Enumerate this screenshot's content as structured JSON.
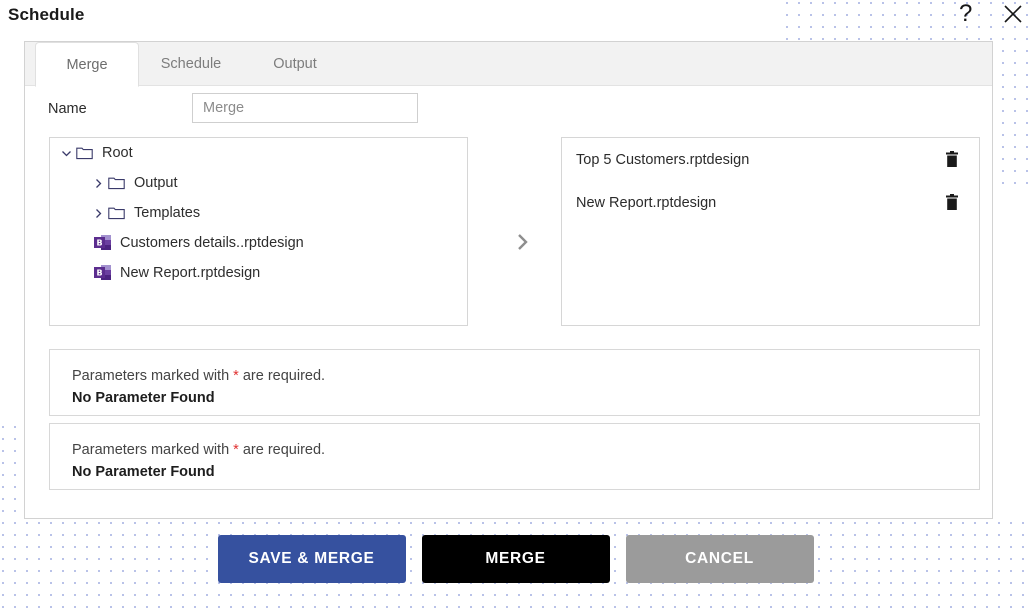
{
  "header": {
    "title": "Schedule",
    "help_icon": "question-mark-icon",
    "close_icon": "close-icon"
  },
  "tabs": [
    {
      "label": "Merge",
      "active": true
    },
    {
      "label": "Schedule",
      "active": false
    },
    {
      "label": "Output",
      "active": false
    }
  ],
  "form": {
    "name_label": "Name",
    "name_value": "",
    "name_placeholder": "Merge"
  },
  "tree": {
    "root": {
      "label": "Root",
      "icon": "folder-icon",
      "caret": "chevron-down-icon",
      "expanded": true
    },
    "folders": [
      {
        "label": "Output",
        "icon": "folder-icon",
        "caret": "chevron-right-icon",
        "expanded": false
      },
      {
        "label": "Templates",
        "icon": "folder-icon",
        "caret": "chevron-right-icon",
        "expanded": false
      }
    ],
    "files": [
      {
        "label": "Customers details..rptdesign",
        "icon": "birt-report-icon"
      },
      {
        "label": "New Report.rptdesign",
        "icon": "birt-report-icon"
      }
    ]
  },
  "transfer": {
    "icon": "chevron-right-icon"
  },
  "selected": {
    "items": [
      {
        "label": "Top 5 Customers.rptdesign",
        "delete_icon": "trash-icon"
      },
      {
        "label": "New Report.rptdesign",
        "delete_icon": "trash-icon"
      }
    ]
  },
  "parameters": [
    {
      "hint_before": "Parameters marked with ",
      "hint_star": "*",
      "hint_after": " are required.",
      "empty_text": "No Parameter Found"
    },
    {
      "hint_before": "Parameters marked with ",
      "hint_star": "*",
      "hint_after": " are required.",
      "empty_text": "No Parameter Found"
    }
  ],
  "actions": {
    "save_merge_label": "SAVE & MERGE",
    "merge_label": "MERGE",
    "cancel_label": "CANCEL"
  },
  "colors": {
    "primary_blue": "#36519f",
    "merge_black": "#000000",
    "cancel_gray": "#9b9b9b",
    "required_red": "#e03131",
    "dot_pattern": "#b9c2e8",
    "file_icon_purple": "#5b2d8e"
  }
}
